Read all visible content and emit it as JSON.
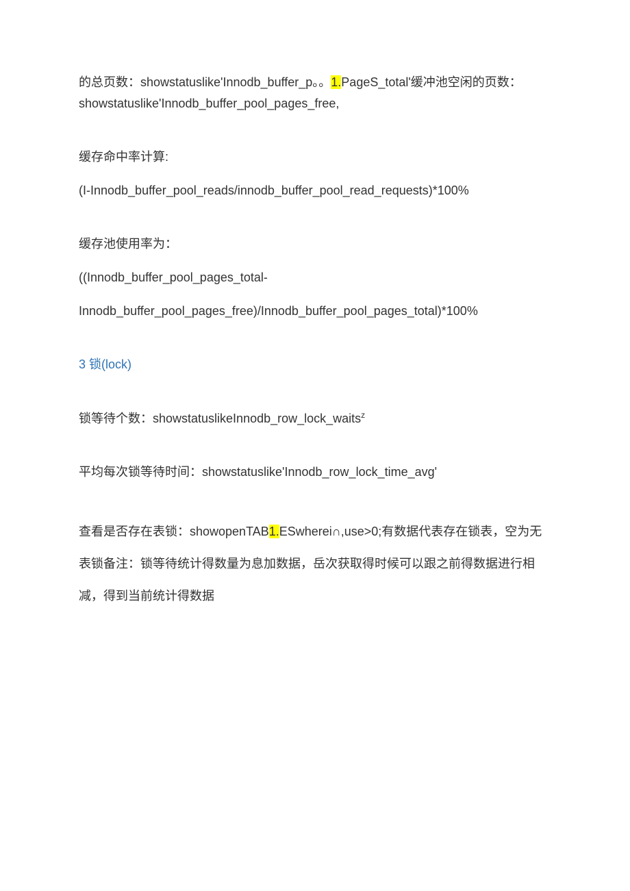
{
  "p1": {
    "part1": "的总页数：showstatuslike'Innodb_buffer_p。。",
    "hl": "1.",
    "part2": "PageS_total'缓冲池空闲的页数：showstatuslike'Innodb_buffer_pool_pages_free,"
  },
  "p2": "缓存命中率计算:",
  "p3": "(I-Innodb_buffer_pool_reads/innodb_buffer_pool_read_requests)*100%",
  "p4": "缓存池使用率为：",
  "p5": "((Innodb_buffer_pool_pages_total-",
  "p6": "Innodb_buffer_pool_pages_free)/Innodb_buffer_pool_pages_total)*100%",
  "heading": "3   锁(lock)",
  "p7": {
    "part1": "锁等待个数：showstatuslikeInnodb_row_lock_waits",
    "sup": "z"
  },
  "p8": "平均每次锁等待时间：showstatuslike'Innodb_row_lock_time_avg'",
  "p9": {
    "part1": "查看是否存在表锁：showopenTAB",
    "hl": "1.",
    "part2": "ESwherei∩,use>0;有数据代表存在锁表，空为无表锁备注：锁等待统计得数量为息加数据，岳次获取得时候可以跟之前得数据进行相减，得到当前统计得数据"
  }
}
